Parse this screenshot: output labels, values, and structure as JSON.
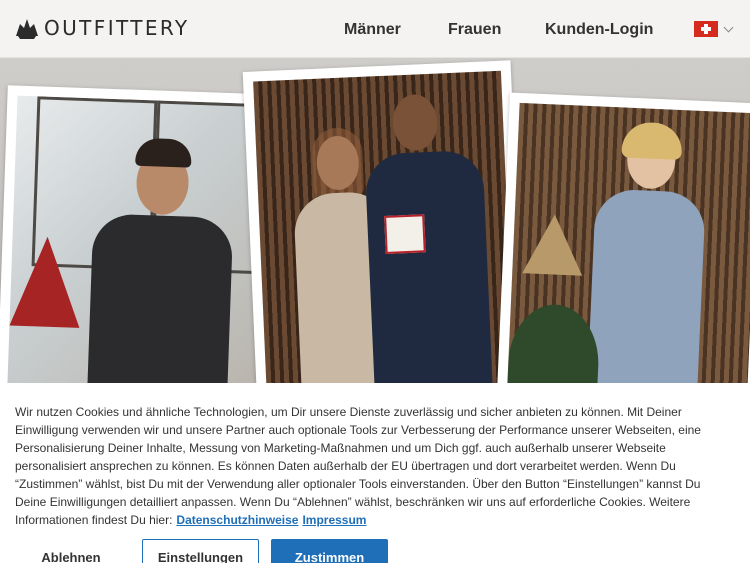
{
  "header": {
    "logo_text": "OUTFITTERY",
    "nav": [
      {
        "label": "Männer"
      },
      {
        "label": "Frauen"
      },
      {
        "label": "Kunden-Login"
      }
    ],
    "country_flag": "swiss-flag-icon"
  },
  "hero": {
    "images": [
      "photo-man-window",
      "photo-couple-gift",
      "photo-woman-christmas"
    ]
  },
  "cookie_banner": {
    "text": "Wir nutzen Cookies und ähnliche Technologien, um Dir unsere Dienste zuverlässig und sicher anbieten zu können. Mit Deiner Einwilligung verwenden wir und unsere Partner auch optionale Tools zur Verbesserung der Performance unserer Webseiten, eine Personalisierung Deiner Inhalte, Messung von Marketing-Maßnahmen und um Dich ggf. auch außerhalb unserer Webseite personalisiert ansprechen zu können. Es können Daten außerhalb der EU übertragen und dort verarbeitet werden. Wenn Du “Zustimmen” wählst, bist Du mit der Verwendung aller optionaler Tools einverstanden. Über den Button “Einstellungen” kannst Du Deine Einwilligungen detailliert anpassen. Wenn Du “Ablehnen” wählst, beschränken wir uns auf erforderliche Cookies. Weitere Informationen findest Du hier:",
    "privacy_link": "Datenschutzhinweise",
    "imprint_link": "Impressum",
    "decline_label": "Ablehnen",
    "settings_label": "Einstellungen",
    "accept_label": "Zustimmen"
  },
  "colors": {
    "accent": "#1f6fb8",
    "header_bg": "#f4f3f1",
    "text": "#333333"
  }
}
